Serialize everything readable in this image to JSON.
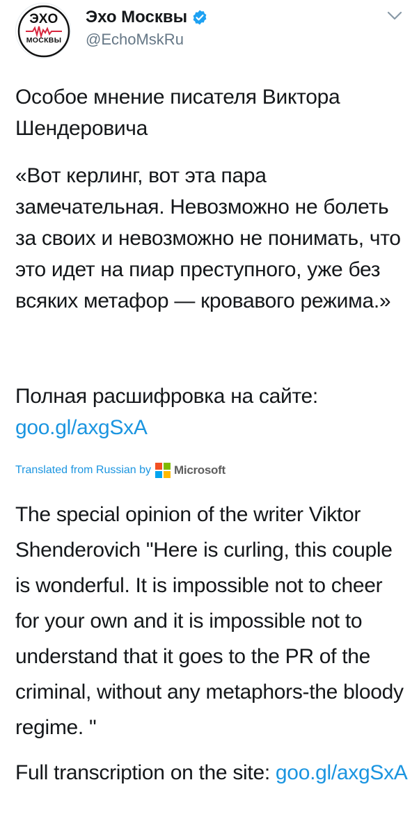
{
  "tweet": {
    "avatar": {
      "top_text": "ЭХО",
      "bottom_text": "МОСКВЫ"
    },
    "display_name": "Эхо Москвы",
    "handle": "@EchoMskRu",
    "verified_icon": "verified-badge-icon",
    "menu_icon": "chevron-down-icon",
    "original": {
      "paragraph_1": "Особое мнение писателя Виктора Шендеровича",
      "paragraph_2": "«Вот керлинг, вот эта пара замечательная. Невозможно не болеть за своих и невозможно не понимать, что это идет на пиар преступного, уже без всяких метафор — кровавого режима.»",
      "paragraph_3_text": "Полная расшифровка на сайте: ",
      "paragraph_3_link": "goo.gl/axgSxA"
    },
    "translation_label": "Translated from Russian by",
    "translation_provider": "Microsoft",
    "translation": {
      "paragraph_1": "The special opinion of the writer Viktor Shenderovich \"Here is curling, this couple is wonderful. It is impossible not to cheer for your own and it is impossible not to understand that it goes to the PR of the criminal, without any metaphors-the bloody regime. \"",
      "paragraph_2_text": "Full transcription on the site: ",
      "paragraph_2_link": "goo.gl/axgSxA"
    },
    "colors": {
      "link": "#1b95e0",
      "text": "#14171a",
      "secondary": "#657786",
      "verified": "#1da1f2"
    }
  }
}
